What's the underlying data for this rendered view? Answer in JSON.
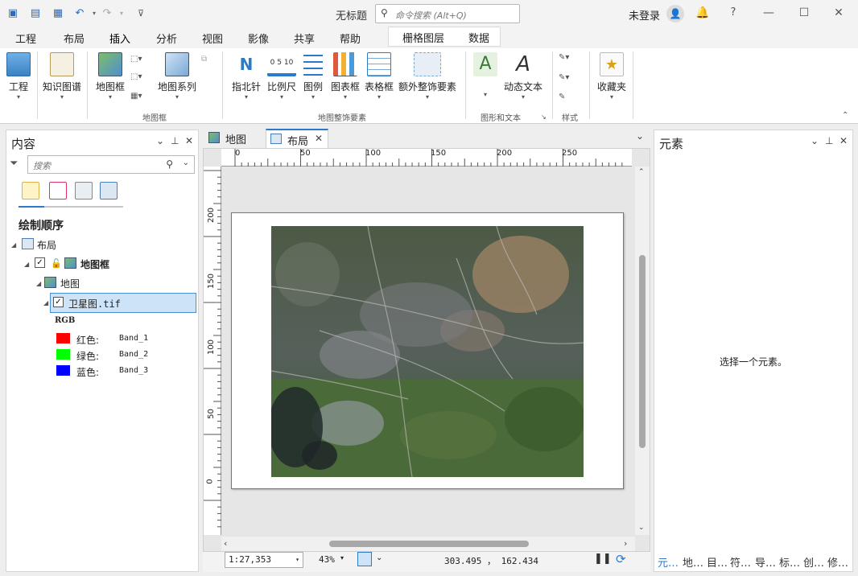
{
  "window": {
    "title": "无标题",
    "login": "未登录",
    "help": "?"
  },
  "command_search": {
    "placeholder": "命令搜索 (Alt+Q)"
  },
  "ribbon_tabs": [
    "工程",
    "布局",
    "插入",
    "分析",
    "视图",
    "影像",
    "共享",
    "帮助"
  ],
  "active_tab": "插入",
  "context_tabs": [
    "栅格图层",
    "数据"
  ],
  "ribbon": {
    "project": "工程",
    "knowledge_graph": "知识图谱",
    "map_frame": "地图框",
    "map_series": "地图系列",
    "north_arrow": "指北针",
    "scale_bar": "比例尺",
    "scale_ticks": "0 5 10",
    "legend": "图例",
    "chart_frame": "图表框",
    "table_frame": "表格框",
    "extra_surround": "额外整饰要素",
    "dynamic_text": "动态文本",
    "favorites": "收藏夹",
    "group_map_frames": "地图框",
    "group_surrounds": "地图整饰要素",
    "group_graphics": "图形和文本",
    "group_styles": "样式"
  },
  "contents": {
    "title": "内容",
    "search_placeholder": "搜索",
    "draw_order": "绘制顺序",
    "tree": {
      "layout": "布局",
      "map_frame": "地图框",
      "map": "地图",
      "layer": "卫星图.tif",
      "renderer": "RGB",
      "bands": [
        {
          "label": "红色:",
          "band": "Band_1",
          "color": "#ff0000"
        },
        {
          "label": "绿色:",
          "band": "Band_2",
          "color": "#00ff00"
        },
        {
          "label": "蓝色:",
          "band": "Band_3",
          "color": "#0000ff"
        }
      ]
    }
  },
  "view_tabs": [
    {
      "label": "地图"
    },
    {
      "label": "布局",
      "active": true
    }
  ],
  "ruler": {
    "horizontal": [
      "0",
      "50",
      "100",
      "150",
      "200",
      "250"
    ],
    "vertical": [
      "200",
      "150",
      "100",
      "50",
      "0"
    ]
  },
  "status": {
    "scale": "1:27,353",
    "zoom": "43%",
    "coords": "303.495 ， 162.434"
  },
  "elements": {
    "title": "元素",
    "empty_message": "选择一个元素。",
    "bottom_tabs": [
      "元…",
      "地…",
      "目…",
      "符…",
      "导…",
      "标…",
      "创…",
      "修…"
    ]
  },
  "colors": {
    "accent": "#2d7bc8",
    "selected_row": "#cde3f7"
  }
}
